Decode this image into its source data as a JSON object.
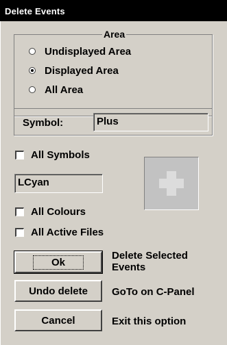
{
  "window": {
    "title": "Delete Events"
  },
  "area": {
    "title": "Area",
    "options": [
      {
        "label": "Undisplayed Area",
        "checked": false
      },
      {
        "label": "Displayed Area",
        "checked": true
      },
      {
        "label": "All Area",
        "checked": false
      }
    ]
  },
  "symbol": {
    "label": "Symbol:",
    "value": "Plus"
  },
  "all_symbols": {
    "label": "All Symbols",
    "checked": false
  },
  "colour": {
    "value": "LCyan"
  },
  "all_colours": {
    "label": "All Colours",
    "checked": false
  },
  "all_active_files": {
    "label": "All Active Files",
    "checked": false
  },
  "buttons": {
    "ok": {
      "label": "Ok",
      "description_line1": "Delete Selected",
      "description_line2": "Events"
    },
    "undo": {
      "label": "Undo delete",
      "description": "GoTo on C-Panel"
    },
    "cancel": {
      "label": "Cancel",
      "description": "Exit this option"
    }
  },
  "colors": {
    "titlebar": "#000000",
    "dialog": "#d4d0c8",
    "preview_bg": "#c2c2c2",
    "symbol_fill": "#dcdcdc"
  },
  "icons": {
    "preview_symbol": "plus-icon"
  }
}
